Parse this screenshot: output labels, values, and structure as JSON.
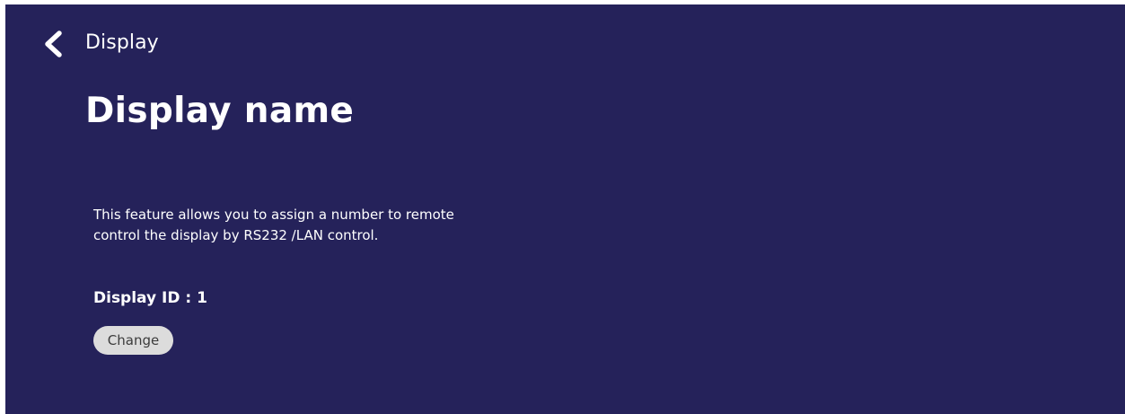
{
  "header": {
    "back_icon": "chevron-left-icon",
    "breadcrumb": "Display"
  },
  "main": {
    "title": "Display name",
    "description_line1": "This feature allows you to assign a number to remote",
    "description_line2": "control the display by RS232 /LAN control.",
    "display_id_label": "Display ID : 1",
    "change_button_label": "Change"
  },
  "colors": {
    "background": "#25225a",
    "text": "#ffffff",
    "button_background": "#dcdcdc",
    "button_text": "#3c3c3c"
  }
}
